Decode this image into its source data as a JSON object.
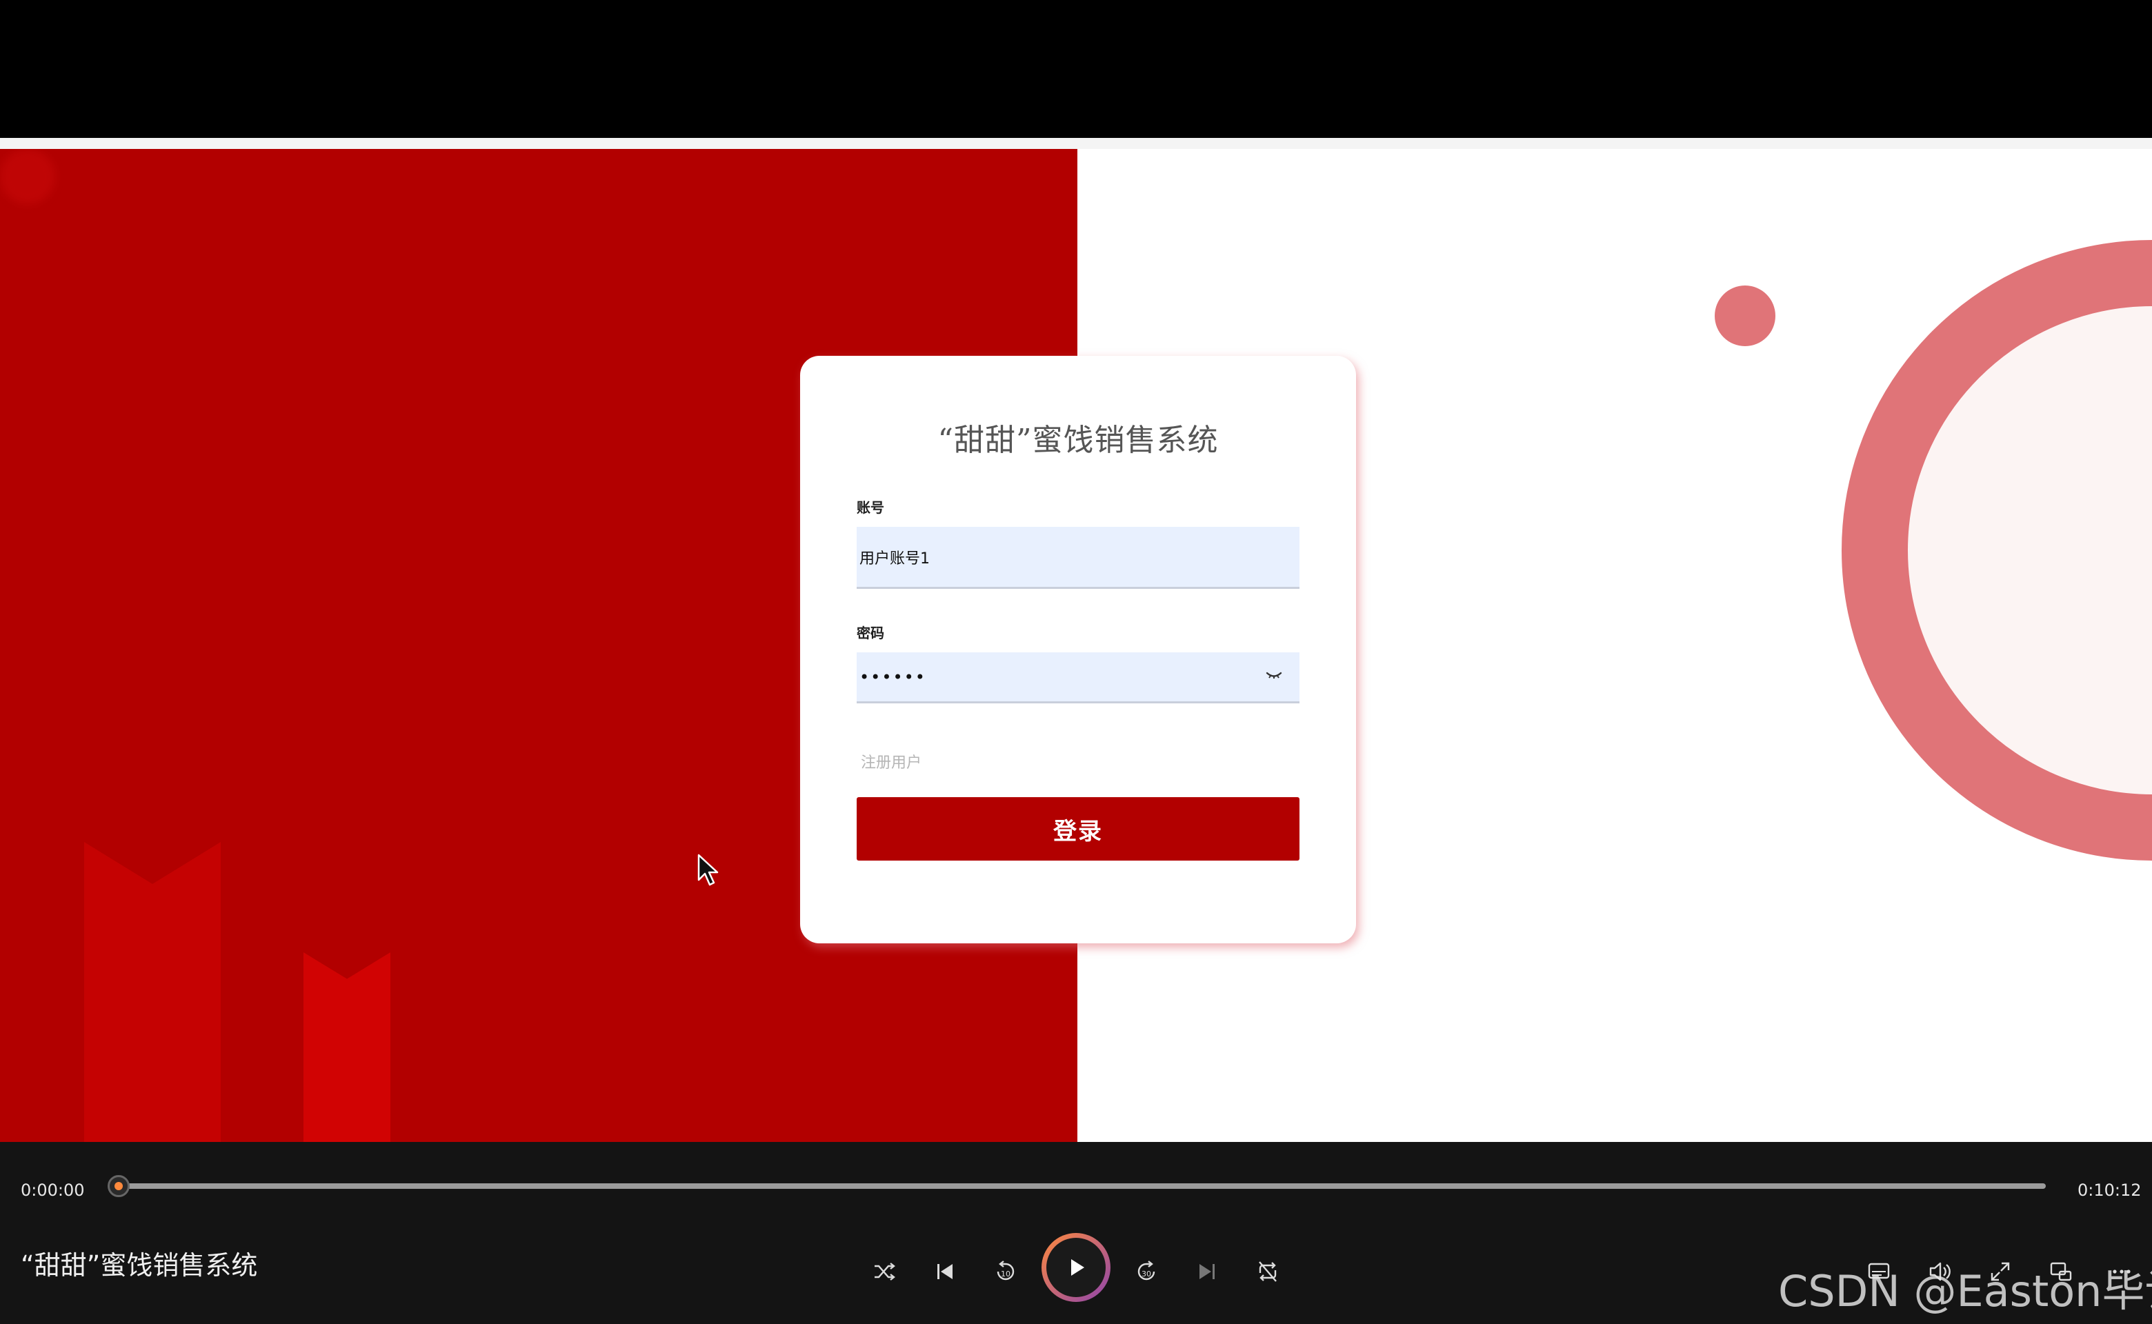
{
  "login": {
    "title": "“甜甜”蜜饯销售系统",
    "account_label": "账号",
    "account_value": "用户账号1",
    "password_label": "密码",
    "password_value": "123456",
    "register_link": "注册用户",
    "login_button": "登录"
  },
  "player": {
    "current_time": "0:00:00",
    "total_time": "0:10:12",
    "progress": 0,
    "media_title": "“甜甜”蜜饯销售系统",
    "rewind_seconds": "10",
    "forward_seconds": "30"
  },
  "watermark": "CSDN @Easton毕设",
  "colors": {
    "brand_red": "#b20000",
    "deco_pink": "#e07478",
    "play_gradient_start": "#ff8a3d",
    "play_gradient_end": "#8e44ad"
  },
  "icons": [
    "shuffle-icon",
    "previous-icon",
    "rewind-10-icon",
    "play-icon",
    "forward-30-icon",
    "next-icon",
    "repeat-off-icon",
    "captions-icon",
    "volume-icon",
    "fullscreen-icon",
    "miniplayer-icon",
    "more-icon",
    "eye-icon",
    "cursor-icon"
  ]
}
